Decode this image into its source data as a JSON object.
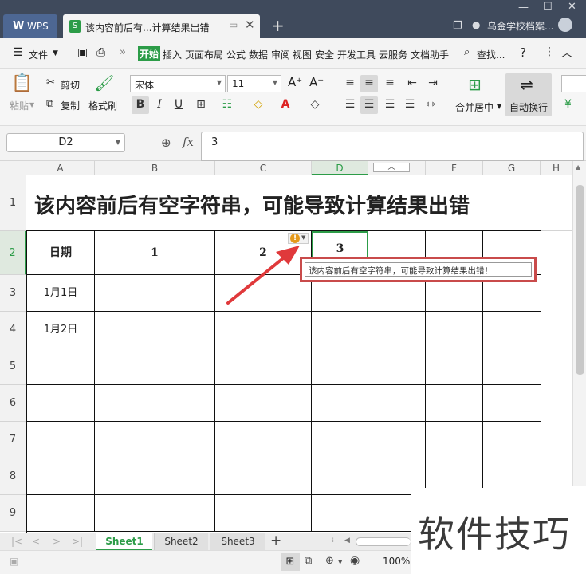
{
  "titlebar": {
    "wps_logo": "W",
    "wps_label": "WPS",
    "doc_icon": "S",
    "doc_tab_label": "该内容前后有...计算结果出错",
    "user_name": "乌金学校档案...",
    "pin_icon": "▭",
    "close_icon": "✕",
    "new_tab_icon": "+",
    "window_min": "—",
    "window_max": "☐",
    "window_close": "✕",
    "restore_icon": "❐"
  },
  "menu": {
    "hamburger": "☰",
    "file": "文件",
    "more": "»",
    "items": [
      "开始",
      "插入",
      "页面布局",
      "公式",
      "数据",
      "审阅",
      "视图",
      "安全",
      "开发工具",
      "云服务",
      "文档助手"
    ],
    "search": "查找...",
    "help": "?",
    "more_menu": "⋮",
    "collapse": "︿"
  },
  "ribbon": {
    "paste": "粘贴",
    "cut": "剪切",
    "copy": "复制",
    "format_painter": "格式刷",
    "font_name": "宋体",
    "font_size": "11",
    "bold": "B",
    "italic": "I",
    "underline": "U",
    "merge_center": "合并居中",
    "wrap_text": "自动换行",
    "grow_font": "A⁺",
    "shrink_font": "A⁻"
  },
  "formula_bar": {
    "name_box": "D2",
    "fx_label": "fx",
    "value": "3"
  },
  "sheet": {
    "columns": [
      "A",
      "B",
      "C",
      "D",
      "E",
      "F",
      "G",
      "H"
    ],
    "rows": [
      "1",
      "2",
      "3",
      "4",
      "5",
      "6",
      "7",
      "8",
      "9"
    ],
    "title_cell": "该内容前后有空字符串，可能导致计算结果出错",
    "header_cells": [
      "日期",
      "1",
      "2",
      "3"
    ],
    "a3": "1月1日",
    "a4": "1月2日",
    "tooltip": "该内容前后有空字符串，可能导致计算结果出错！",
    "warning_icon": "!"
  },
  "sheet_tabs": [
    "Sheet1",
    "Sheet2",
    "Sheet3"
  ],
  "add_sheet": "+",
  "status": {
    "zoom": "100%"
  },
  "watermark": "软件技巧",
  "colors": {
    "accent_green": "#2c9c48",
    "titlebar": "#3f4a5c",
    "tooltip_border": "#c94b4b",
    "arrow_red": "#e0393b"
  }
}
